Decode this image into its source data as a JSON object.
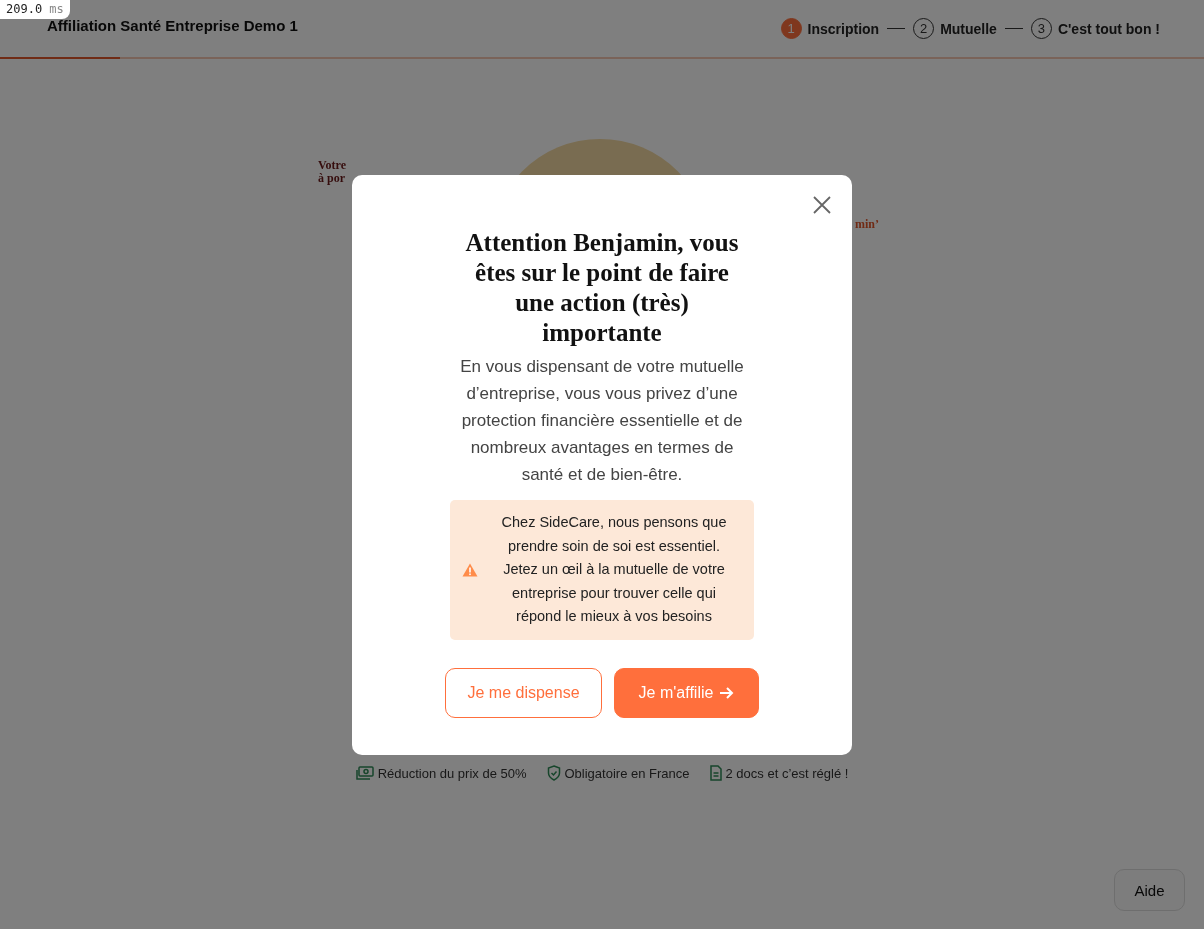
{
  "perf_badge": {
    "value": "209.0",
    "unit": "ms"
  },
  "header": {
    "title": "Affiliation Santé Entreprise Demo 1",
    "progress": {
      "level": 0.1
    },
    "steps": [
      {
        "number": "1",
        "label": "Inscription",
        "selected": true
      },
      {
        "number": "2",
        "label": "Mutuelle",
        "selected": false
      },
      {
        "number": "3",
        "label": "C'est tout bon !",
        "selected": false
      }
    ]
  },
  "background": {
    "left_text": [
      "Votre",
      "à por"
    ],
    "right_text": "min’",
    "features": [
      {
        "kind": "money",
        "label": "Réduction du prix de 50%"
      },
      {
        "kind": "shield",
        "label": "Obligatoire en France"
      },
      {
        "kind": "document",
        "label": "2 docs et c’est réglé !"
      }
    ]
  },
  "modal": {
    "title": "Attention Benjamin, vous êtes sur le point de faire une action (très) importante",
    "body": "En vous dispensant de votre mutuelle d’entreprise, vous vous privez d’une protection financière essentielle et de nombreux avantages en termes de santé et de bien-être.",
    "alert": {
      "text": "Chez SideCare, nous pensons que prendre soin de soi est essentiel. Jetez un œil à la mutuelle de votre entreprise pour trouver celle qui répond le mieux à vos besoins"
    },
    "buttons": [
      {
        "kind": "outline",
        "label": "Je me dispense"
      },
      {
        "kind": "primary",
        "label": "Je m'affilie"
      }
    ]
  },
  "help_button": {
    "label": "Aide"
  }
}
